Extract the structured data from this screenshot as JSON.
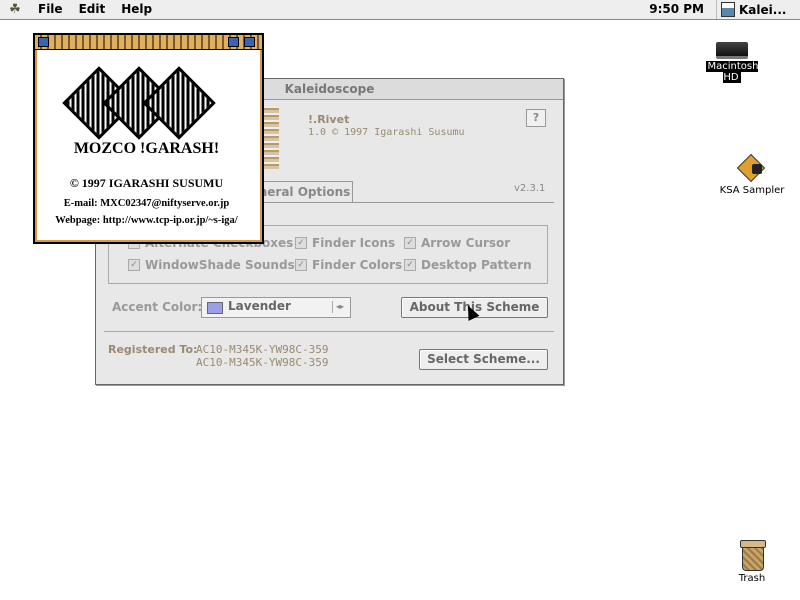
{
  "menubar": {
    "apple_icon": "apple-menu-icon",
    "items": [
      "File",
      "Edit",
      "Help"
    ],
    "clock": "9:50 PM",
    "app_name": "Kalei..."
  },
  "desktop": {
    "hd_label": "Macintosh HD",
    "ksa_label": "KSA Sampler",
    "trash_label": "Trash"
  },
  "window": {
    "title": "Kaleidoscope",
    "scheme_name": "!.Rivet",
    "scheme_info": "1.0 © 1997 Igarashi Susumu",
    "help_label": "?",
    "version": "v2.3.1",
    "tab_label": "neral Options",
    "checkboxes": [
      {
        "label": "Alternate Checkboxes",
        "checked": true
      },
      {
        "label": "Finder Icons",
        "checked": true
      },
      {
        "label": "Arrow Cursor",
        "checked": true
      },
      {
        "label": "WindowShade Sounds",
        "checked": true
      },
      {
        "label": "Finder Colors",
        "checked": true
      },
      {
        "label": "Desktop Pattern",
        "checked": true
      }
    ],
    "accent_label": "Accent Color:",
    "accent_value": "Lavender",
    "about_button": "About This Scheme",
    "registered_label": "Registered To:",
    "registered_line1": "AC10-M345K-YW98C-359",
    "registered_line2": "AC10-M345K-YW98C-359",
    "select_button": "Select Scheme..."
  },
  "about": {
    "logo_text": "MOZCO !GARASH!",
    "copyright": "© 1997 IGARASHI SUSUMU",
    "email": "E-mail: MXC02347@niftyserve.or.jp",
    "webpage": "Webpage: http://www.tcp-ip.or.jp/~s-iga/"
  },
  "colors": {
    "accent_swatch": "#9aa0e8",
    "about_frame": "#d79a3a",
    "disabled_text": "#999999"
  }
}
